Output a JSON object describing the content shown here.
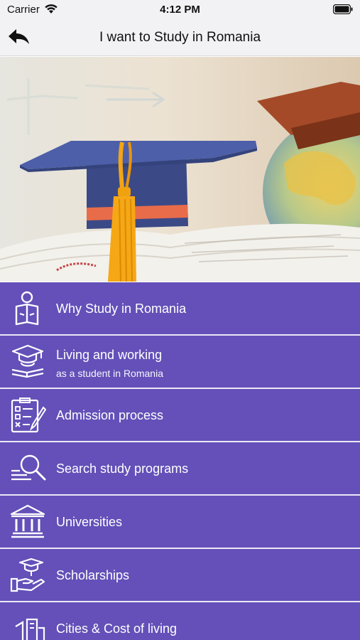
{
  "status": {
    "carrier": "Carrier",
    "time": "4:12 PM"
  },
  "nav": {
    "title": "I want to Study in Romania",
    "back_icon": "back-arrow-icon"
  },
  "hero": {
    "image": "graduation-cap-on-book-with-globe"
  },
  "colors": {
    "menu_background": "#6450b8",
    "divider": "#ece8f6",
    "nav_background": "#f2f2f4"
  },
  "menu": [
    {
      "label": "Why Study in Romania",
      "icon": "reading-person-icon"
    },
    {
      "label": "Living and working",
      "sublabel": "as a student in Romania",
      "icon": "graduate-books-icon"
    },
    {
      "label": "Admission process",
      "icon": "checklist-icon"
    },
    {
      "label": "Search study programs",
      "icon": "search-icon"
    },
    {
      "label": "Universities",
      "icon": "university-building-icon"
    },
    {
      "label": "Scholarships",
      "icon": "scholarship-hand-icon"
    },
    {
      "label": "Cities & Cost of living",
      "icon": "city-icon"
    }
  ]
}
